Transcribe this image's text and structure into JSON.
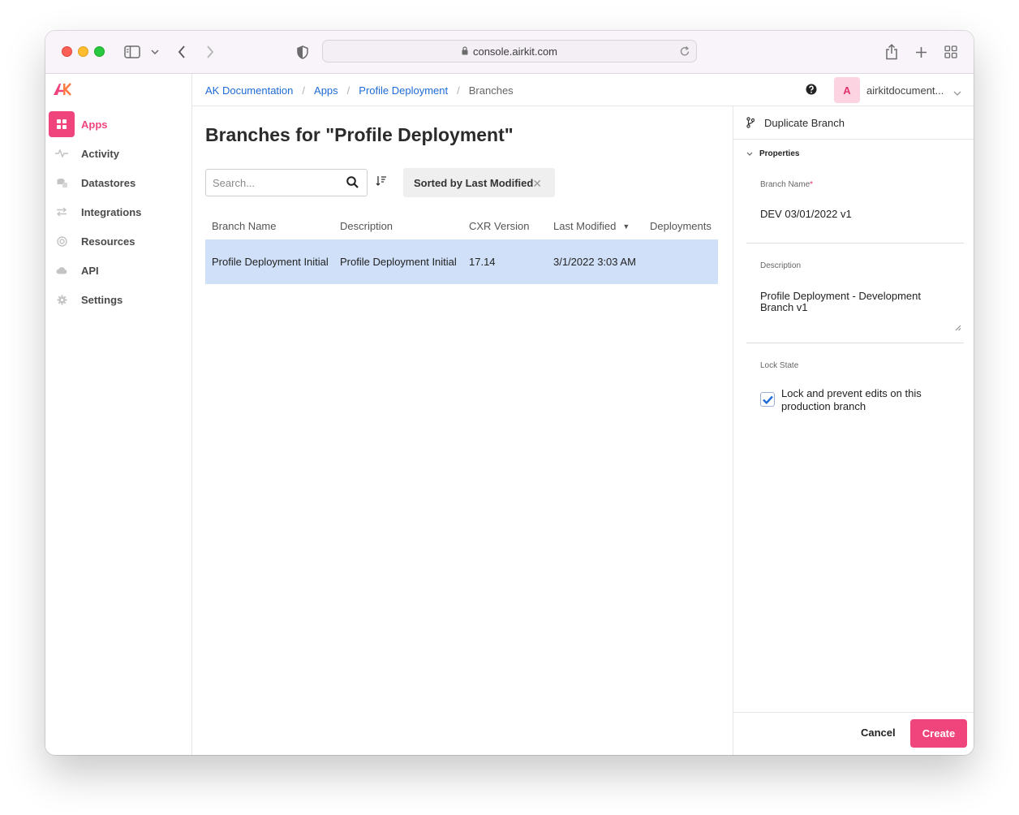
{
  "browser": {
    "url": "console.airkit.com"
  },
  "sidebar": {
    "items": [
      {
        "label": "Apps",
        "icon": "apps-icon",
        "active": true
      },
      {
        "label": "Activity",
        "icon": "activity-icon"
      },
      {
        "label": "Datastores",
        "icon": "datastores-icon"
      },
      {
        "label": "Integrations",
        "icon": "integrations-icon"
      },
      {
        "label": "Resources",
        "icon": "resources-icon"
      },
      {
        "label": "API",
        "icon": "cloud-icon"
      },
      {
        "label": "Settings",
        "icon": "gear-icon"
      }
    ]
  },
  "breadcrumb": {
    "items": [
      "AK Documentation",
      "Apps",
      "Profile Deployment"
    ],
    "current": "Branches"
  },
  "account": {
    "initial": "A",
    "name": "airkitdocument..."
  },
  "main": {
    "title": "Branches for \"Profile Deployment\"",
    "search_placeholder": "Search...",
    "sort_chip": "Sorted by Last Modified",
    "table": {
      "columns": [
        "Branch Name",
        "Description",
        "CXR Version",
        "Last Modified",
        "Deployments"
      ],
      "rows": [
        {
          "branch_name": "Profile Deployment Initial",
          "description": "Profile Deployment Initial",
          "cxr_version": "17.14",
          "last_modified": "3/1/2022 3:03 AM",
          "deployments": ""
        }
      ]
    }
  },
  "panel": {
    "title": "Duplicate Branch",
    "section": "Properties",
    "branch_name_label": "Branch Name",
    "branch_name_required": "*",
    "branch_name_value": "DEV 03/01/2022 v1",
    "description_label": "Description",
    "description_value": "Profile Deployment - Development Branch v1",
    "lock_label": "Lock State",
    "lock_text": "Lock and prevent edits on this production branch",
    "lock_checked": true,
    "cancel_label": "Cancel",
    "create_label": "Create"
  },
  "colors": {
    "accent": "#f0447c",
    "link": "#1e6bd6",
    "selected_row": "#cfe0f8"
  }
}
